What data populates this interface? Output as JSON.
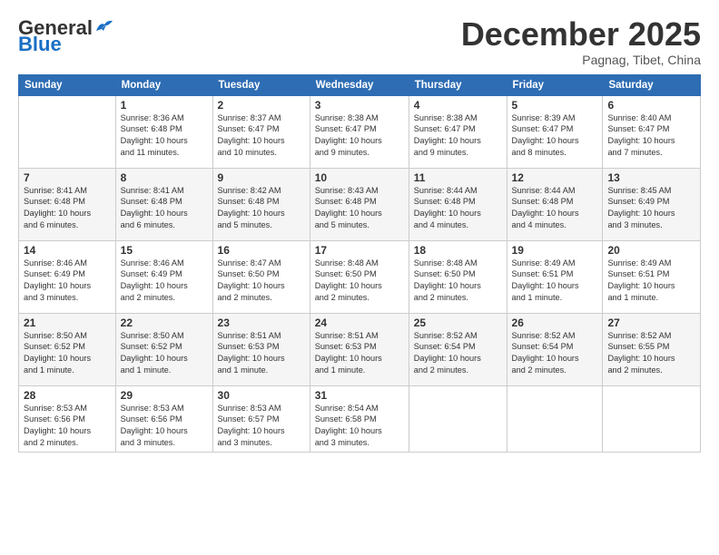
{
  "header": {
    "logo_general": "General",
    "logo_blue": "Blue",
    "month": "December 2025",
    "location": "Pagnag, Tibet, China"
  },
  "weekdays": [
    "Sunday",
    "Monday",
    "Tuesday",
    "Wednesday",
    "Thursday",
    "Friday",
    "Saturday"
  ],
  "weeks": [
    [
      {
        "day": "",
        "info": ""
      },
      {
        "day": "1",
        "info": "Sunrise: 8:36 AM\nSunset: 6:48 PM\nDaylight: 10 hours\nand 11 minutes."
      },
      {
        "day": "2",
        "info": "Sunrise: 8:37 AM\nSunset: 6:47 PM\nDaylight: 10 hours\nand 10 minutes."
      },
      {
        "day": "3",
        "info": "Sunrise: 8:38 AM\nSunset: 6:47 PM\nDaylight: 10 hours\nand 9 minutes."
      },
      {
        "day": "4",
        "info": "Sunrise: 8:38 AM\nSunset: 6:47 PM\nDaylight: 10 hours\nand 9 minutes."
      },
      {
        "day": "5",
        "info": "Sunrise: 8:39 AM\nSunset: 6:47 PM\nDaylight: 10 hours\nand 8 minutes."
      },
      {
        "day": "6",
        "info": "Sunrise: 8:40 AM\nSunset: 6:47 PM\nDaylight: 10 hours\nand 7 minutes."
      }
    ],
    [
      {
        "day": "7",
        "info": "Sunrise: 8:41 AM\nSunset: 6:48 PM\nDaylight: 10 hours\nand 6 minutes."
      },
      {
        "day": "8",
        "info": "Sunrise: 8:41 AM\nSunset: 6:48 PM\nDaylight: 10 hours\nand 6 minutes."
      },
      {
        "day": "9",
        "info": "Sunrise: 8:42 AM\nSunset: 6:48 PM\nDaylight: 10 hours\nand 5 minutes."
      },
      {
        "day": "10",
        "info": "Sunrise: 8:43 AM\nSunset: 6:48 PM\nDaylight: 10 hours\nand 5 minutes."
      },
      {
        "day": "11",
        "info": "Sunrise: 8:44 AM\nSunset: 6:48 PM\nDaylight: 10 hours\nand 4 minutes."
      },
      {
        "day": "12",
        "info": "Sunrise: 8:44 AM\nSunset: 6:48 PM\nDaylight: 10 hours\nand 4 minutes."
      },
      {
        "day": "13",
        "info": "Sunrise: 8:45 AM\nSunset: 6:49 PM\nDaylight: 10 hours\nand 3 minutes."
      }
    ],
    [
      {
        "day": "14",
        "info": "Sunrise: 8:46 AM\nSunset: 6:49 PM\nDaylight: 10 hours\nand 3 minutes."
      },
      {
        "day": "15",
        "info": "Sunrise: 8:46 AM\nSunset: 6:49 PM\nDaylight: 10 hours\nand 2 minutes."
      },
      {
        "day": "16",
        "info": "Sunrise: 8:47 AM\nSunset: 6:50 PM\nDaylight: 10 hours\nand 2 minutes."
      },
      {
        "day": "17",
        "info": "Sunrise: 8:48 AM\nSunset: 6:50 PM\nDaylight: 10 hours\nand 2 minutes."
      },
      {
        "day": "18",
        "info": "Sunrise: 8:48 AM\nSunset: 6:50 PM\nDaylight: 10 hours\nand 2 minutes."
      },
      {
        "day": "19",
        "info": "Sunrise: 8:49 AM\nSunset: 6:51 PM\nDaylight: 10 hours\nand 1 minute."
      },
      {
        "day": "20",
        "info": "Sunrise: 8:49 AM\nSunset: 6:51 PM\nDaylight: 10 hours\nand 1 minute."
      }
    ],
    [
      {
        "day": "21",
        "info": "Sunrise: 8:50 AM\nSunset: 6:52 PM\nDaylight: 10 hours\nand 1 minute."
      },
      {
        "day": "22",
        "info": "Sunrise: 8:50 AM\nSunset: 6:52 PM\nDaylight: 10 hours\nand 1 minute."
      },
      {
        "day": "23",
        "info": "Sunrise: 8:51 AM\nSunset: 6:53 PM\nDaylight: 10 hours\nand 1 minute."
      },
      {
        "day": "24",
        "info": "Sunrise: 8:51 AM\nSunset: 6:53 PM\nDaylight: 10 hours\nand 1 minute."
      },
      {
        "day": "25",
        "info": "Sunrise: 8:52 AM\nSunset: 6:54 PM\nDaylight: 10 hours\nand 2 minutes."
      },
      {
        "day": "26",
        "info": "Sunrise: 8:52 AM\nSunset: 6:54 PM\nDaylight: 10 hours\nand 2 minutes."
      },
      {
        "day": "27",
        "info": "Sunrise: 8:52 AM\nSunset: 6:55 PM\nDaylight: 10 hours\nand 2 minutes."
      }
    ],
    [
      {
        "day": "28",
        "info": "Sunrise: 8:53 AM\nSunset: 6:56 PM\nDaylight: 10 hours\nand 2 minutes."
      },
      {
        "day": "29",
        "info": "Sunrise: 8:53 AM\nSunset: 6:56 PM\nDaylight: 10 hours\nand 3 minutes."
      },
      {
        "day": "30",
        "info": "Sunrise: 8:53 AM\nSunset: 6:57 PM\nDaylight: 10 hours\nand 3 minutes."
      },
      {
        "day": "31",
        "info": "Sunrise: 8:54 AM\nSunset: 6:58 PM\nDaylight: 10 hours\nand 3 minutes."
      },
      {
        "day": "",
        "info": ""
      },
      {
        "day": "",
        "info": ""
      },
      {
        "day": "",
        "info": ""
      }
    ]
  ]
}
